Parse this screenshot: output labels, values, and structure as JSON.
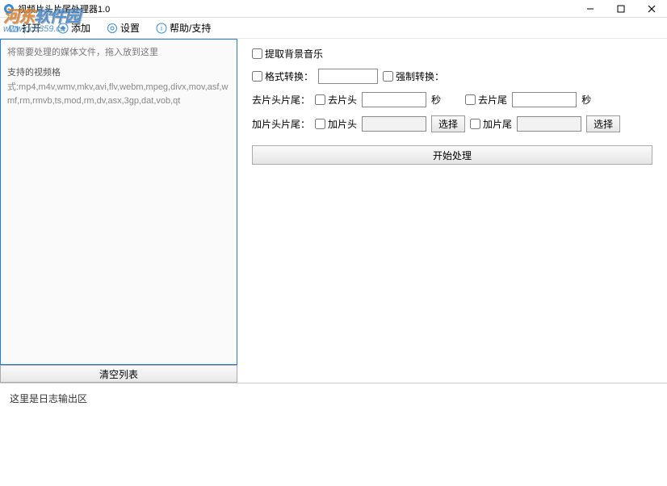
{
  "window": {
    "title": "视频片头片尾处理器1.0"
  },
  "watermark": {
    "brand_head": "河东",
    "brand_tail": "软件园",
    "url": "www.pc0359.cn"
  },
  "toolbar": {
    "open_label": "打开",
    "add_label": "添加",
    "settings_label": "设置",
    "help_label": "帮助/支持"
  },
  "left": {
    "drag_hint": "将需要处理的媒体文件，拖入放到这里",
    "formats_title": "支持的视频格",
    "formats_list": "式:mp4,m4v,wmv,mkv,avi,flv,webm,mpeg,divx,mov,asf,wmf,rm,rmvb,ts,mod,rm,dv,asx,3gp,dat,vob,qt",
    "clear_button": "清空列表"
  },
  "options": {
    "extract_bgm_label": "提取背景音乐",
    "format_convert_label": "格式转换：",
    "force_convert_label": "强制转换：",
    "trim_label": "去片头片尾：",
    "trim_head_label": "去片头",
    "trim_tail_label": "去片尾",
    "trim_head_value": "",
    "trim_tail_value": "",
    "seconds_unit": "秒",
    "add_label": "加片头片尾：",
    "add_head_label": "加片头",
    "add_tail_label": "加片尾",
    "add_head_value": "",
    "add_tail_value": "",
    "select_button": "选择",
    "format_value": ""
  },
  "actions": {
    "start_label": "开始处理"
  },
  "log": {
    "placeholder": "这里是日志输出区"
  }
}
